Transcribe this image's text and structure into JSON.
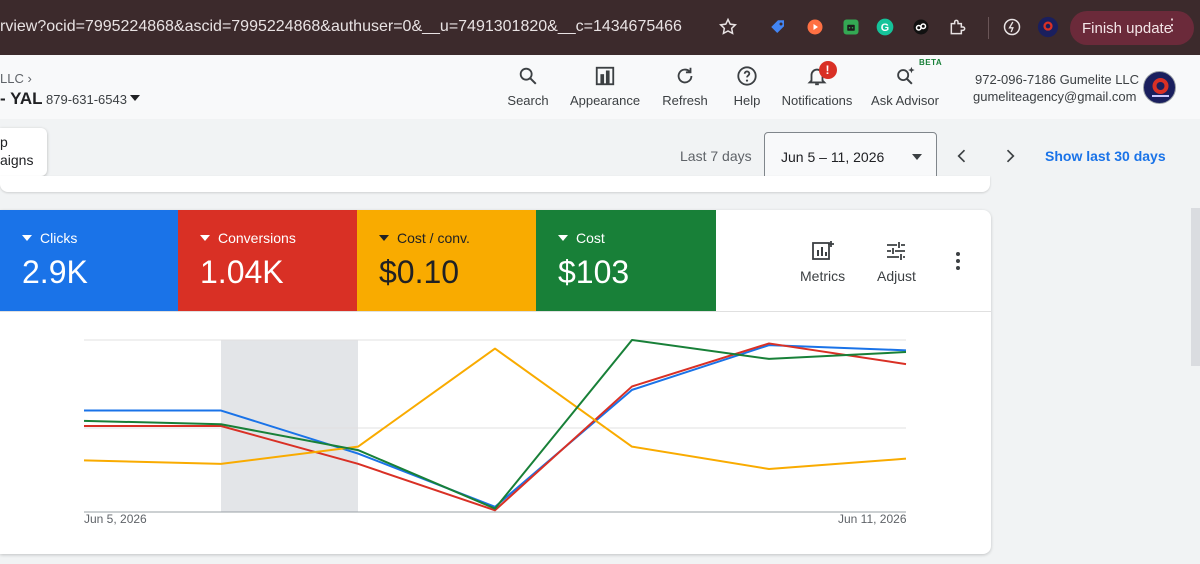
{
  "browser": {
    "url": "rview?ocid=7995224868&ascid=7995224868&authuser=0&__u=7491301820&__c=1434675466",
    "finish_update": "Finish update"
  },
  "account": {
    "parent": "LLC",
    "name": "- YAL",
    "id": "879-631-6543"
  },
  "toolbar": {
    "search": "Search",
    "appearance": "Appearance",
    "refresh": "Refresh",
    "help": "Help",
    "notifications": "Notifications",
    "notification_badge": "!",
    "ask_advisor": "Ask Advisor",
    "beta": "BETA"
  },
  "user": {
    "line1": "972-096-7186 Gumelite LLC",
    "email": "gumeliteagency@gmail.com"
  },
  "subbar": {
    "campaigns_line1": "p",
    "campaigns_line2": "aigns",
    "range_label": "Last 7 days",
    "date_range": "Jun 5 – 11, 2026",
    "show_last": "Show last 30 days"
  },
  "metrics": [
    {
      "label": "Clicks",
      "value": "2.9K",
      "color": "#1a73e8"
    },
    {
      "label": "Conversions",
      "value": "1.04K",
      "color": "#d93025"
    },
    {
      "label": "Cost / conv.",
      "value": "$0.10",
      "color": "#f9ab00"
    },
    {
      "label": "Cost",
      "value": "$103",
      "color": "#188038"
    }
  ],
  "card_tools": {
    "metrics": "Metrics",
    "adjust": "Adjust"
  },
  "chart_data": {
    "type": "line",
    "x": [
      "Jun 5, 2026",
      "Jun 6, 2026",
      "Jun 7, 2026",
      "Jun 8, 2026",
      "Jun 9, 2026",
      "Jun 10, 2026",
      "Jun 11, 2026"
    ],
    "x_tick_labels": [
      "Jun 5, 2026",
      "Jun 11, 2026"
    ],
    "highlighted_x": "Jun 6, 2026",
    "grid": true,
    "ylim": [
      0,
      1
    ],
    "series": [
      {
        "name": "Clicks",
        "color": "#1a73e8",
        "values": [
          0.59,
          0.59,
          0.34,
          0.03,
          0.71,
          0.97,
          0.94
        ]
      },
      {
        "name": "Conversions",
        "color": "#d93025",
        "values": [
          0.5,
          0.5,
          0.28,
          0.01,
          0.73,
          0.98,
          0.86
        ]
      },
      {
        "name": "Cost / conv.",
        "color": "#f9ab00",
        "values": [
          0.3,
          0.28,
          0.38,
          0.95,
          0.38,
          0.25,
          0.31
        ]
      },
      {
        "name": "Cost",
        "color": "#188038",
        "values": [
          0.53,
          0.51,
          0.36,
          0.02,
          1.0,
          0.89,
          0.93
        ]
      }
    ]
  }
}
